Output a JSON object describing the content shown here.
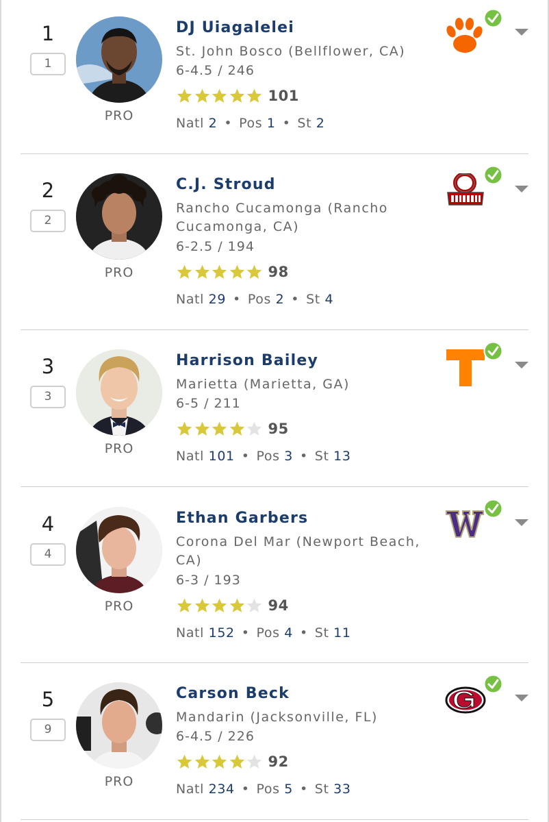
{
  "players": [
    {
      "rank": "1",
      "prev_rank": "1",
      "name": "DJ Uiagalelei",
      "school": "St. John Bosco (Bellflower, CA)",
      "ht_wt": "6-4.5 / 246",
      "star_count": 5,
      "rating": "101",
      "pro_label": "PRO",
      "natl_label": "Natl",
      "natl": "2",
      "pos_label": "Pos",
      "pos": "1",
      "st_label": "St",
      "st": "2",
      "college_icon": "clemson-paw-logo",
      "college_color": "#F56600"
    },
    {
      "rank": "2",
      "prev_rank": "2",
      "name": "C.J. Stroud",
      "school": "Rancho Cucamonga (Rancho Cucamonga, CA)",
      "ht_wt": "6-2.5 / 194",
      "star_count": 5,
      "rating": "98",
      "pro_label": "PRO",
      "natl_label": "Natl",
      "natl": "29",
      "pos_label": "Pos",
      "pos": "2",
      "st_label": "St",
      "st": "4",
      "college_icon": "ohio-state-logo",
      "college_color": "#BB0000"
    },
    {
      "rank": "3",
      "prev_rank": "3",
      "name": "Harrison Bailey",
      "school": "Marietta (Marietta, GA)",
      "ht_wt": "6-5 / 211",
      "star_count": 4,
      "rating": "95",
      "pro_label": "PRO",
      "natl_label": "Natl",
      "natl": "101",
      "pos_label": "Pos",
      "pos": "3",
      "st_label": "St",
      "st": "13",
      "college_icon": "tennessee-t-logo",
      "college_color": "#FF8200"
    },
    {
      "rank": "4",
      "prev_rank": "4",
      "name": "Ethan Garbers",
      "school": "Corona Del Mar (Newport Beach, CA)",
      "ht_wt": "6-3 / 193",
      "star_count": 4,
      "rating": "94",
      "pro_label": "PRO",
      "natl_label": "Natl",
      "natl": "152",
      "pos_label": "Pos",
      "pos": "4",
      "st_label": "St",
      "st": "11",
      "college_icon": "washington-w-logo",
      "college_color": "#4B2E83"
    },
    {
      "rank": "5",
      "prev_rank": "9",
      "name": "Carson Beck",
      "school": "Mandarin (Jacksonville, FL)",
      "ht_wt": "6-4.5 / 226",
      "star_count": 4,
      "rating": "92",
      "pro_label": "PRO",
      "natl_label": "Natl",
      "natl": "234",
      "pos_label": "Pos",
      "pos": "5",
      "st_label": "St",
      "st": "33",
      "college_icon": "georgia-g-logo",
      "college_color": "#BA0C2F"
    }
  ],
  "colors": {
    "name": "#1c3d6b",
    "star_filled": "#d9c93a",
    "star_empty": "#e3e3e3",
    "commit_check": "#76c043"
  },
  "icons": {
    "committed": "check-circle-icon",
    "expand": "chevron-down-icon",
    "star": "star-icon"
  }
}
